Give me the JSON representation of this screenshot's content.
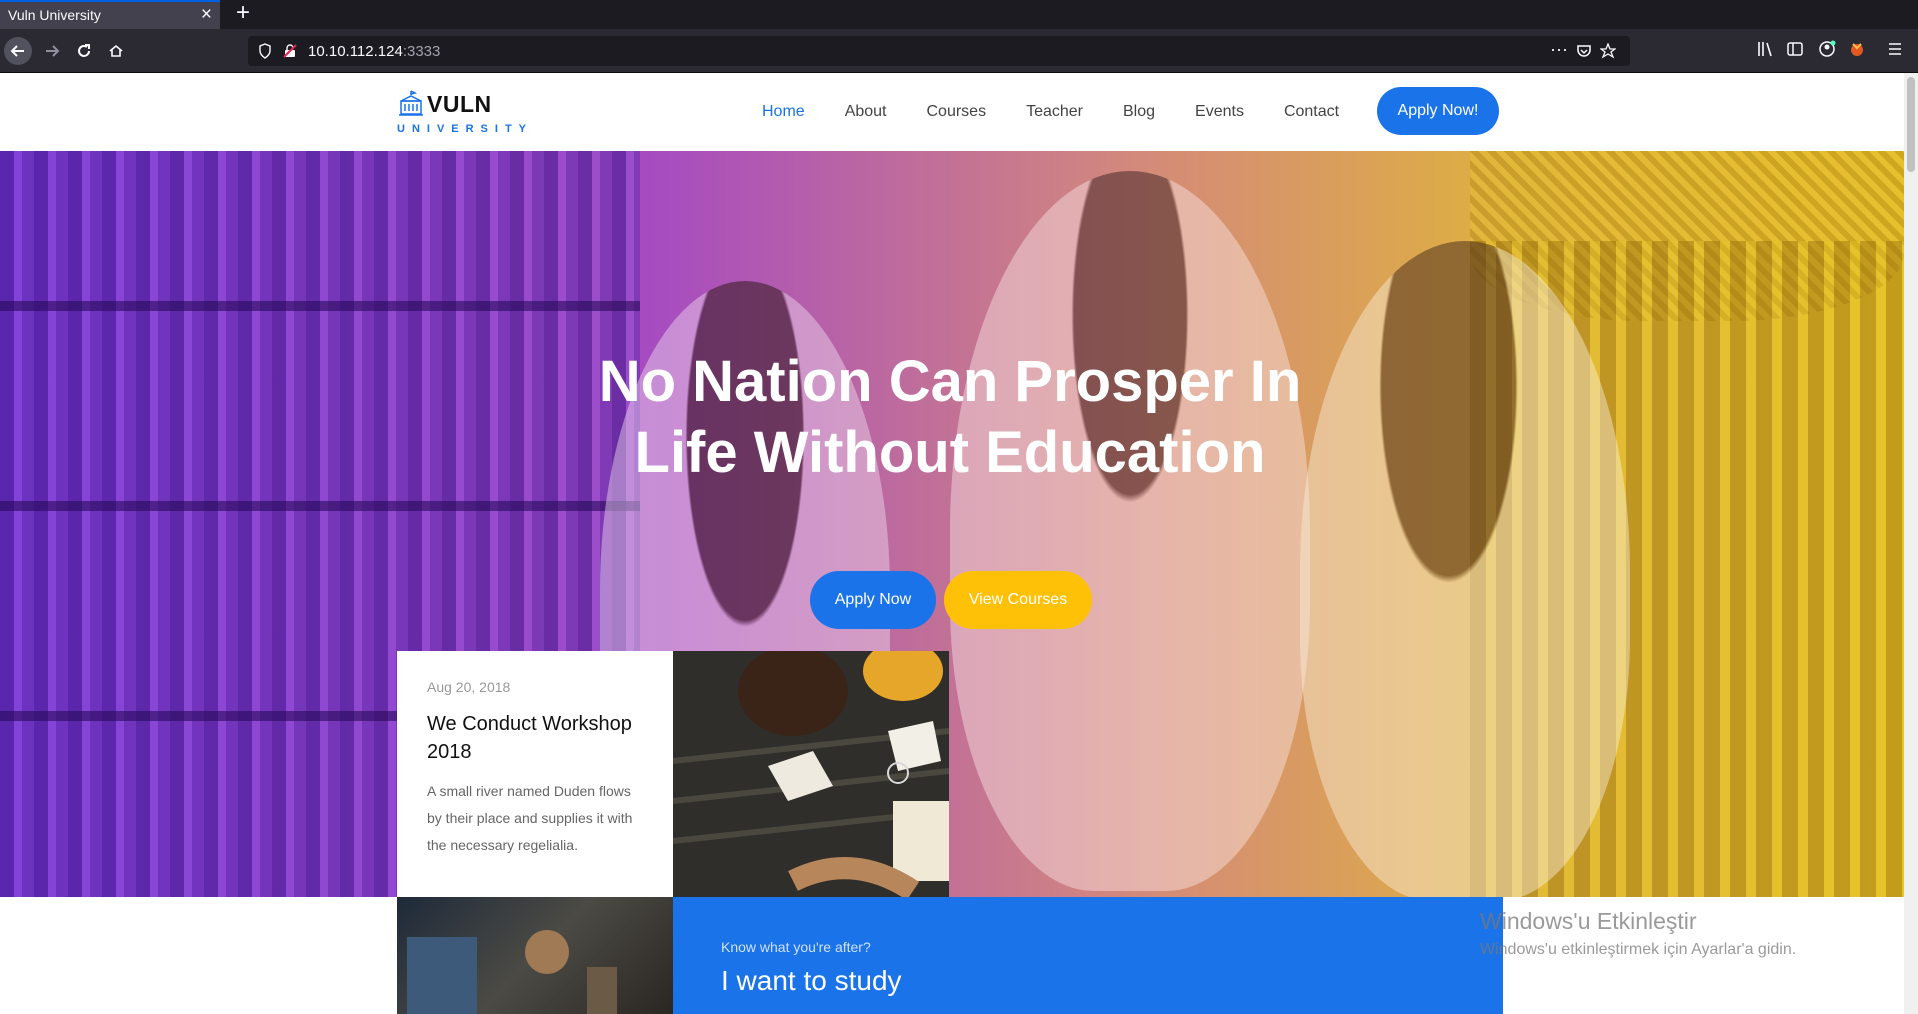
{
  "browser": {
    "tab_title": "Vuln University",
    "url_host": "10.10.112.124",
    "url_port": ":3333"
  },
  "site": {
    "logo_name": "VULN",
    "logo_sub": "UNIVERSITY",
    "nav": [
      "Home",
      "About",
      "Courses",
      "Teacher",
      "Blog",
      "Events",
      "Contact"
    ],
    "cta": "Apply Now!"
  },
  "hero": {
    "title_line1": "No Nation Can Prosper In",
    "title_line2": "Life Without Education",
    "apply_button": "Apply Now",
    "courses_button": "View Courses"
  },
  "event": {
    "date": "Aug 20, 2018",
    "title": "We Conduct Workshop 2018",
    "description": "A small river named Duden flows by their place and supplies it with the necessary regelialia."
  },
  "study": {
    "kicker": "Know what you're after?",
    "title": "I want to study"
  },
  "watermark": {
    "title": "Windows'u Etkinleştir",
    "subtitle": "Windows'u etkinleştirmek için Ayarlar'a gidin."
  },
  "colors": {
    "primary": "#1a73e8",
    "secondary": "#ffc107"
  }
}
